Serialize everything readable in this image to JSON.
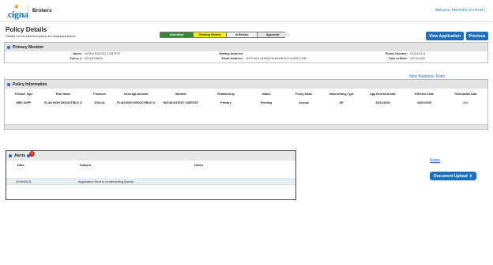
{
  "header": {
    "logo_text": "cigna",
    "brand": "Brokers",
    "welcome": "Welcome, PRUTHVI SAI RAM ›"
  },
  "page": {
    "title": "Policy Details",
    "subtitle": "Details for the selected policy are displayed below"
  },
  "stepper": {
    "steps": [
      "Submitted",
      "Pending Review",
      "In Review",
      "Approved"
    ],
    "active_index": 1
  },
  "buttons": {
    "view_application": "View Application",
    "previous": "Previous",
    "document_upload": "Document Upload"
  },
  "primary_member": {
    "section_title": "Primary Member",
    "name_label": "Name:",
    "name_value": "INITIALEATEST CSBTEST",
    "policy_label": "Policy #:",
    "policy_value": "63910006626",
    "mailing_label": "Mailing Address:",
    "mailing_value": "",
    "email_label": "Email Address:",
    "email_value": "JEFF.MULLINS@CIGNAHEALTHCARE.COM",
    "phone_label": "Phone Number:",
    "phone_value": "3131111111",
    "dob_label": "Date of Birth:",
    "dob_value": "03/23/1960"
  },
  "links": {
    "new_business_team": "New Business Team",
    "notes": "Notes"
  },
  "policy_information": {
    "section_title": "Policy Information",
    "columns": [
      "Product Type",
      "Plan Name",
      "Premium",
      "Coverage Amount",
      "Member",
      "Relationship",
      "Status",
      "Policy Mode",
      "Underwriting Type",
      "App Received Date",
      "Effective Date",
      "Termination Date"
    ],
    "rows": [
      [
        "MED SUPP",
        "PLAN HIGH DEDUCTIBLE G",
        "$784.34",
        "PLAN HIGH DEDUCTIBLE G",
        "INITIALEATEST CSBTEST",
        "Primary",
        "Pending",
        "Annual",
        "OE",
        "03/21/2025",
        "04/01/2025",
        "N/A"
      ]
    ]
  },
  "alerts": {
    "section_title": "Alerts",
    "badge_count": "1",
    "columns": [
      "Date",
      "Subject",
      "Notes"
    ],
    "rows": [
      [
        "2025/03/21",
        "Application Sent to Underwriting Queue",
        ""
      ]
    ]
  },
  "colors": {
    "primary_blue": "#1f6fbf",
    "step_submitted": "#2e8b2e",
    "step_pending": "#f6f10a",
    "badge_red": "#d52b1e"
  }
}
